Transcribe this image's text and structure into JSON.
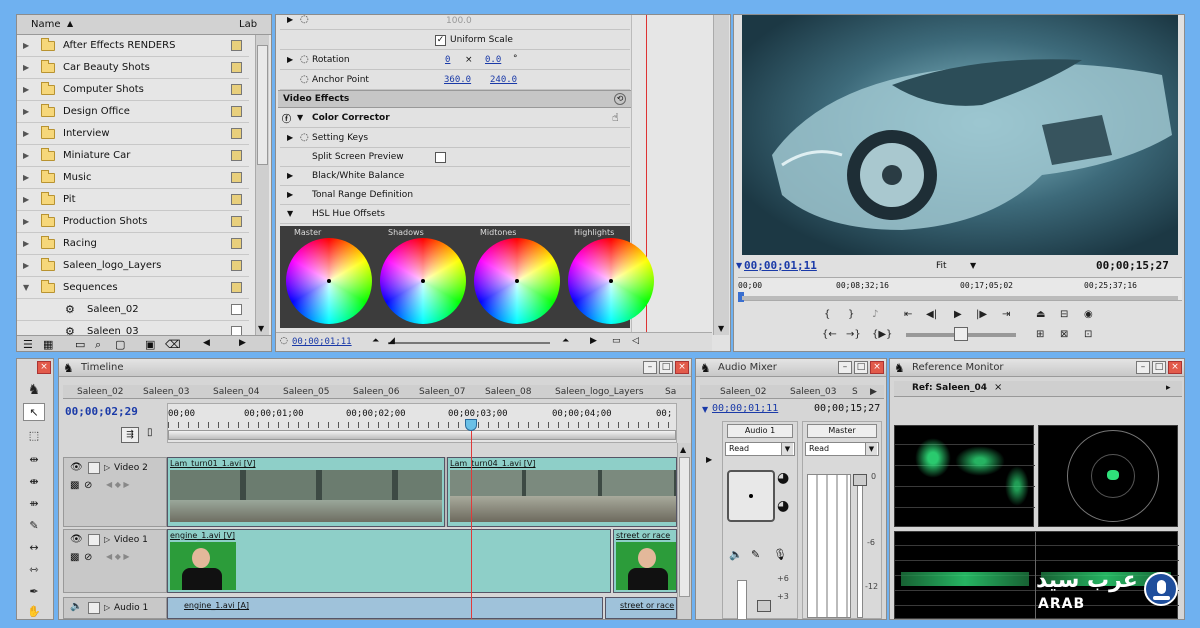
{
  "project": {
    "col_name": "Name",
    "col_label": "Lab",
    "items": [
      {
        "label": "After Effects RENDERS",
        "type": "folder",
        "expanded": false
      },
      {
        "label": "Car Beauty Shots",
        "type": "folder",
        "expanded": false
      },
      {
        "label": "Computer Shots",
        "type": "folder",
        "expanded": false
      },
      {
        "label": "Design Office",
        "type": "folder",
        "expanded": false
      },
      {
        "label": "Interview",
        "type": "folder",
        "expanded": false
      },
      {
        "label": "Miniature Car",
        "type": "folder",
        "expanded": false
      },
      {
        "label": "Music",
        "type": "folder",
        "expanded": false
      },
      {
        "label": "Pit",
        "type": "folder",
        "expanded": false
      },
      {
        "label": "Production Shots",
        "type": "folder",
        "expanded": false
      },
      {
        "label": "Racing",
        "type": "folder",
        "expanded": false
      },
      {
        "label": "Saleen_logo_Layers",
        "type": "folder",
        "expanded": false
      },
      {
        "label": "Sequences",
        "type": "folder",
        "expanded": true
      },
      {
        "label": "Saleen_02",
        "type": "sequence"
      },
      {
        "label": "Saleen_03",
        "type": "sequence"
      }
    ]
  },
  "effects": {
    "scale_value": "100.0",
    "uniform_scale": "Uniform Scale",
    "rotation_label": "Rotation",
    "rotation_rev": "0",
    "rotation_x": "×",
    "rotation_deg": "0.0",
    "rotation_unit": "°",
    "anchor_label": "Anchor Point",
    "anchor_x": "360.0",
    "anchor_y": "240.0",
    "video_effects": "Video Effects",
    "color_corrector": "Color Corrector",
    "setting_keys": "Setting Keys",
    "split_screen": "Split Screen Preview",
    "bw_balance": "Black/White Balance",
    "tonal_range": "Tonal Range Definition",
    "hsl_offsets": "HSL Hue Offsets",
    "wheels": [
      "Master",
      "Shadows",
      "Midtones",
      "Highlights"
    ],
    "timecode": "00;00;01;11"
  },
  "monitor": {
    "current_tc": "00;00;01;11",
    "fit": "Fit",
    "duration_tc": "00;00;15;27",
    "ruler": [
      "00;00",
      "00;08;32;16",
      "00;17;05;02",
      "00;25;37;16"
    ]
  },
  "timeline": {
    "title": "Timeline",
    "tabs": [
      "Saleen_02",
      "Saleen_03",
      "Saleen_04",
      "Saleen_05",
      "Saleen_06",
      "Saleen_07",
      "Saleen_08",
      "Saleen_logo_Layers",
      "Sa"
    ],
    "current_tc": "00;00;02;29",
    "ruler": [
      "00;00",
      "00;00;01;00",
      "00;00;02;00",
      "00;00;03;00",
      "00;00;04;00",
      "00;"
    ],
    "tracks": {
      "video2": "Video 2",
      "video1": "Video 1",
      "audio1": "Audio 1"
    },
    "clips": {
      "v2a": "Lam_turn01_1.avi [V]",
      "v2b": "Lam_turn04_1.avi [V]",
      "v1a": "engine_1.avi [V]",
      "v1b": "street or race",
      "a1a": "engine_1.avi [A]",
      "a1b": "street or race"
    }
  },
  "audio_mixer": {
    "title": "Audio Mixer",
    "tabs": [
      "Saleen_02",
      "Saleen_03",
      "S"
    ],
    "tc_left": "00;00;01;11",
    "tc_right": "00;00;15;27",
    "ch1": "Audio 1",
    "master": "Master",
    "mode1": "Read",
    "mode2": "Read",
    "scale": [
      "0",
      "-6",
      "-12"
    ],
    "scale_plus": [
      "+6",
      "+3"
    ]
  },
  "reference": {
    "title": "Reference Monitor",
    "ref_tab": "Ref: Saleen_04"
  },
  "watermark": {
    "arabic": "عرب سيد",
    "latin": "ARAB"
  },
  "colors": {
    "accent": "#1a3aa8",
    "clip_teal": "#8ecfc8",
    "scope_green": "#2fe07a",
    "bg": "#6fb1f0"
  }
}
